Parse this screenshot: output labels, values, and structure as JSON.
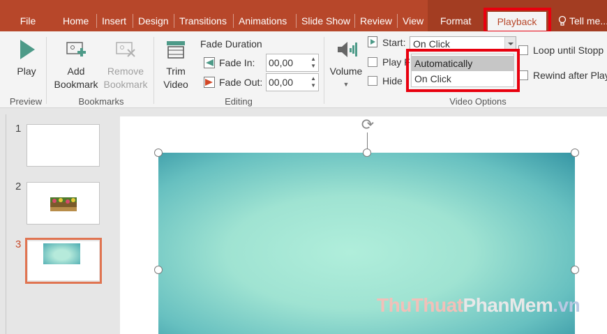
{
  "tabs": {
    "file": "File",
    "home": "Home",
    "insert": "Insert",
    "design": "Design",
    "transitions": "Transitions",
    "animations": "Animations",
    "slideshow": "Slide Show",
    "review": "Review",
    "view": "View",
    "format": "Format",
    "playback": "Playback",
    "tell_me": "Tell me..."
  },
  "ribbon": {
    "preview": {
      "play_label": "Play",
      "group_label": "Preview"
    },
    "bookmarks": {
      "add_line1": "Add",
      "add_line2": "Bookmark",
      "remove_line1": "Remove",
      "remove_line2": "Bookmark",
      "group_label": "Bookmarks"
    },
    "editing": {
      "trim_line1": "Trim",
      "trim_line2": "Video",
      "fade_duration": "Fade Duration",
      "fade_in_label": "Fade In:",
      "fade_in_value": "00,00",
      "fade_out_label": "Fade Out:",
      "fade_out_value": "00,00",
      "group_label": "Editing"
    },
    "video_options": {
      "volume_label": "Volume",
      "start_label": "Start:",
      "start_value": "On Click",
      "play_full_label": "Play F",
      "hide_label": "Hide",
      "loop_label": "Loop until Stopp",
      "rewind_label": "Rewind after Play",
      "dropdown_options": [
        "Automatically",
        "On Click"
      ],
      "selected_option": "Automatically",
      "group_label": "Video Options"
    }
  },
  "slides": [
    {
      "number": "1"
    },
    {
      "number": "2"
    },
    {
      "number": "3"
    }
  ],
  "watermark": {
    "part1": "ThuThuat",
    "part2": "PhanMem",
    "part3": ".vn"
  },
  "colors": {
    "accent": "#b7472a",
    "highlight": "#e8000e",
    "active_slide_border": "#e07451"
  }
}
